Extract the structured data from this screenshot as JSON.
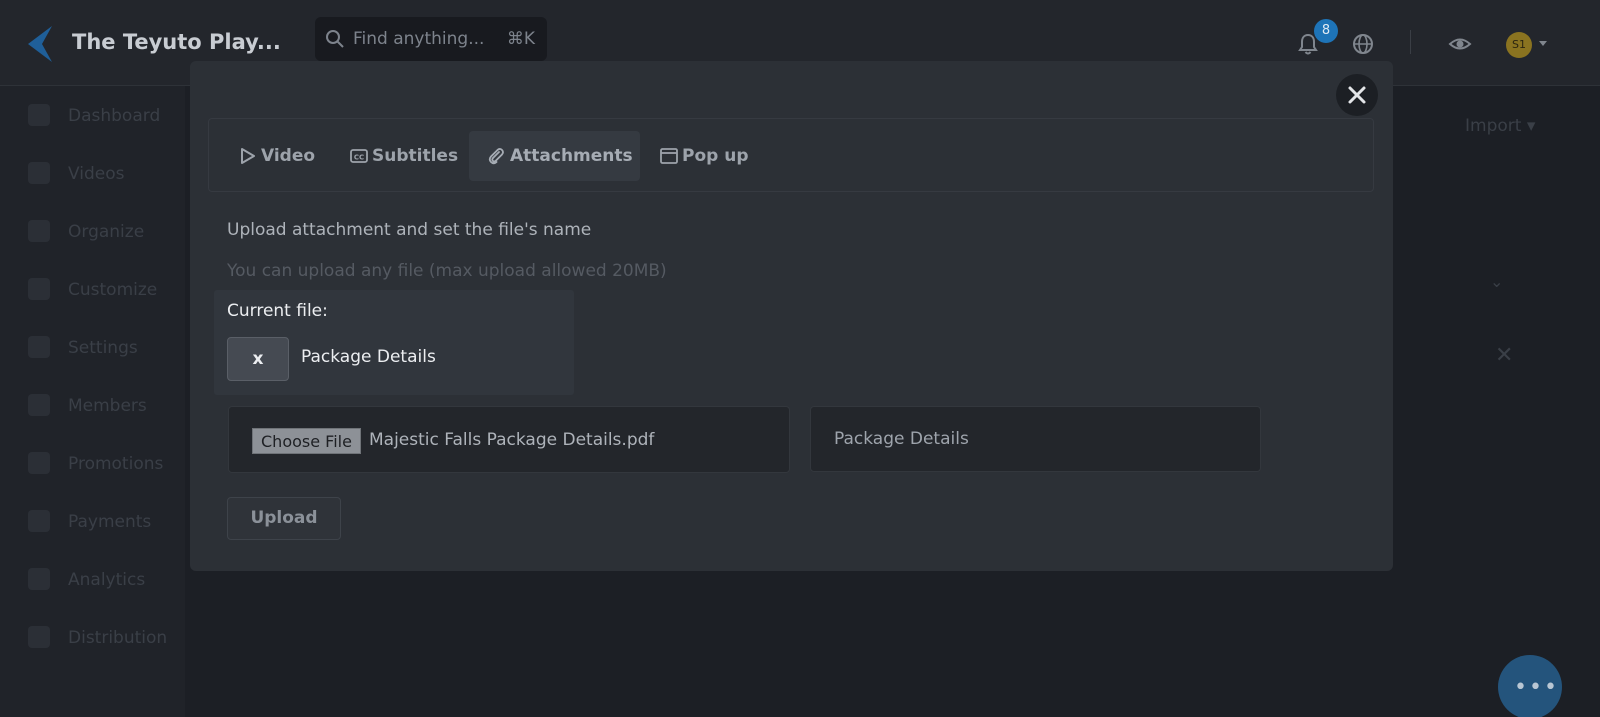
{
  "app": {
    "title": "The Teyuto Play...",
    "search_placeholder": "Find anything...",
    "search_shortcut": "⌘K",
    "notification_count": "8",
    "avatar_initials": "S1",
    "accent_color": "#1e74b8"
  },
  "sidebar": {
    "items": [
      {
        "label": "Dashboard",
        "icon": "dashboard-icon"
      },
      {
        "label": "Videos",
        "icon": "video-icon"
      },
      {
        "label": "Organize",
        "icon": "organize-icon"
      },
      {
        "label": "Customize",
        "icon": "brush-icon"
      },
      {
        "label": "Settings",
        "icon": "settings-icon"
      },
      {
        "label": "Members",
        "icon": "members-icon"
      },
      {
        "label": "Promotions",
        "icon": "gift-icon"
      },
      {
        "label": "Payments",
        "icon": "wallet-icon"
      },
      {
        "label": "Analytics",
        "icon": "chart-icon"
      },
      {
        "label": "Distribution",
        "icon": "distribution-icon"
      }
    ]
  },
  "background": {
    "import_label": "Import ▾"
  },
  "modal": {
    "tabs": [
      {
        "label": "Video",
        "icon": "play-icon"
      },
      {
        "label": "Subtitles",
        "icon": "cc-icon"
      },
      {
        "label": "Attachments",
        "icon": "paperclip-icon"
      },
      {
        "label": "Pop up",
        "icon": "window-icon"
      }
    ],
    "active_tab": "Attachments",
    "heading": "Upload attachment and set the file's name",
    "hint": "You can upload any file (max upload allowed 20MB)",
    "file_input": {
      "button_label": "Choose File",
      "selected_file": "Majestic Falls Package Details.pdf"
    },
    "name_input": {
      "value": "Package Details"
    },
    "upload_label": "Upload"
  },
  "popover": {
    "title": "Current file:",
    "remove_label": "x",
    "file_name": "Package Details"
  }
}
